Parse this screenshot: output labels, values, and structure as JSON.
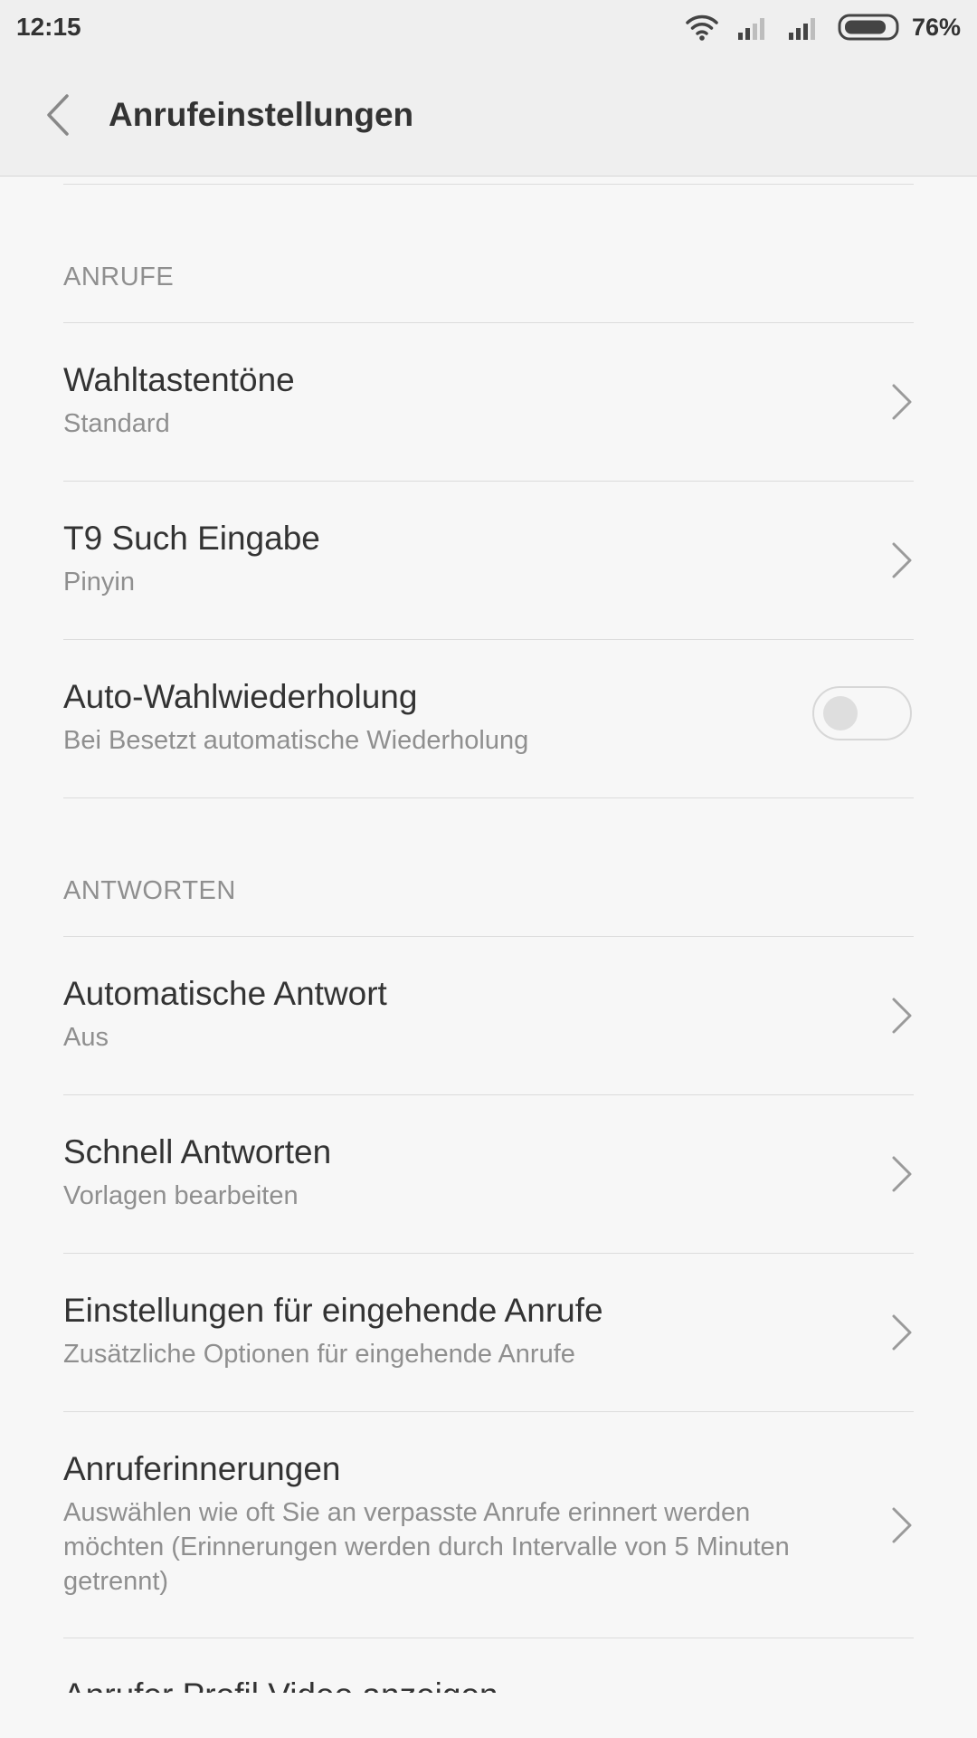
{
  "status_bar": {
    "time": "12:15",
    "battery": "76%",
    "icons": [
      "wifi-icon",
      "signal-icon",
      "signal-icon",
      "battery-icon"
    ]
  },
  "app_bar": {
    "title": "Anrufeinstellungen",
    "back_icon": "chevron-left-icon"
  },
  "sections": {
    "calls": {
      "header": "ANRUFE",
      "items": [
        {
          "title": "Wahltastentöne",
          "subtitle": "Standard"
        },
        {
          "title": "T9 Such Eingabe",
          "subtitle": "Pinyin"
        },
        {
          "title": "Auto-Wahlwiederholung",
          "subtitle": "Bei Besetzt automatische Wiederholung",
          "toggle": false
        }
      ]
    },
    "answers": {
      "header": "ANTWORTEN",
      "items": [
        {
          "title": "Automatische Antwort",
          "subtitle": "Aus"
        },
        {
          "title": "Schnell Antworten",
          "subtitle": "Vorlagen bearbeiten"
        },
        {
          "title": "Einstellungen für eingehende Anrufe",
          "subtitle": "Zusätzliche Optionen für eingehende Anrufe"
        },
        {
          "title": "Anruferinnerungen",
          "subtitle": "Auswählen wie oft Sie an verpasste Anrufe erinnert werden möchten (Erinnerungen werden durch Intervalle von 5 Minuten getrennt)"
        },
        {
          "title": "Anrufer Profil Video anzeigen"
        }
      ]
    }
  }
}
